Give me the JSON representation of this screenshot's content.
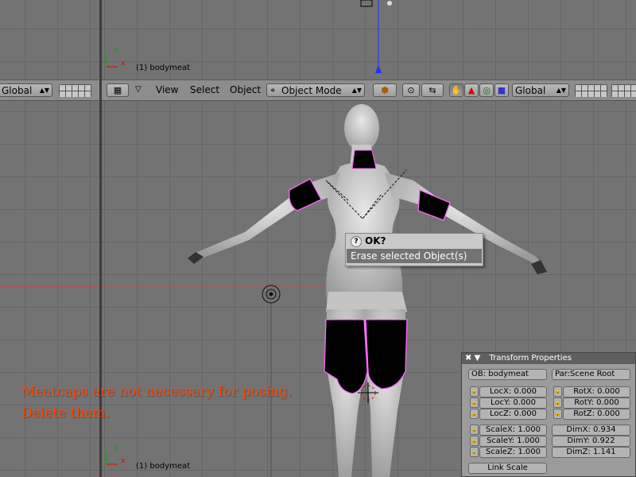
{
  "left_header": {
    "transform_orientation": "Global"
  },
  "header": {
    "view_menu": "View",
    "select_menu": "Select",
    "object_menu": "Object",
    "mode": "Object Mode",
    "transform_orientation": "Global",
    "icons": [
      "grid-icon",
      "menu-triangle-icon",
      "mode-icon",
      "shading-sphere-icon",
      "pivot-icon",
      "snap-icon",
      "hand-icon",
      "rotate-manipulator-icon",
      "scale-manipulator-icon",
      "translate-manipulator-icon"
    ]
  },
  "viewports": {
    "top_label": "(1) bodymeat",
    "bottom_label": "(1) bodymeat",
    "axis_x": "x",
    "axis_z": "z"
  },
  "dialog": {
    "title": "OK?",
    "item": "Erase selected Object(s)"
  },
  "annotation": {
    "line1": "Meatcaps are not necessary for posing.",
    "line2": "Delete them."
  },
  "transform_panel": {
    "title": "Transform Properties",
    "ob": "OB: bodymeat",
    "parent": "Par:Scene Root",
    "loc_x": "LocX: 0.000",
    "loc_y": "LocY: 0.000",
    "loc_z": "LocZ: 0.000",
    "rot_x": "RotX: 0.000",
    "rot_y": "RotY: 0.000",
    "rot_z": "RotZ: 0.000",
    "scale_x": "ScaleX: 1.000",
    "scale_y": "ScaleY: 1.000",
    "scale_z": "ScaleZ: 1.000",
    "dim_x": "DimX: 0.934",
    "dim_y": "DimY: 0.922",
    "dim_z": "DimZ: 1.141",
    "link_scale": "Link Scale"
  },
  "colors": {
    "selection_outline": "#ff66ff",
    "annotation_text": "#ff4500",
    "background": "#737373"
  }
}
